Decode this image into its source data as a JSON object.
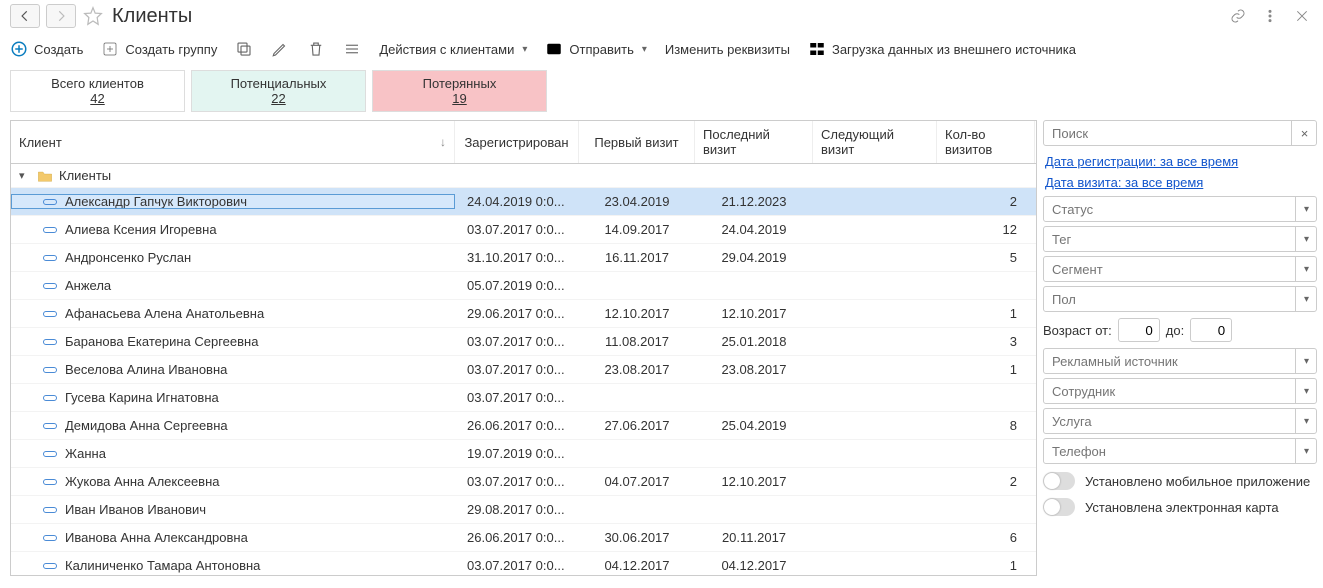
{
  "title": "Клиенты",
  "toolbar": {
    "create": "Создать",
    "create_group": "Создать группу",
    "actions": "Действия с клиентами",
    "send": "Отправить",
    "edit_req": "Изменить реквизиты",
    "load_ext": "Загрузка данных из внешнего источника"
  },
  "stats": {
    "all_label": "Всего клиентов",
    "all_count": "42",
    "potential_label": "Потенциальных",
    "potential_count": "22",
    "lost_label": "Потерянных",
    "lost_count": "19"
  },
  "columns": {
    "client": "Клиент",
    "registered": "Зарегистрирован",
    "first_visit": "Первый визит",
    "last_visit": "Последний визит",
    "next_visit": "Следующий визит",
    "visit_count": "Кол-во визитов"
  },
  "group_label": "Клиенты",
  "rows": [
    {
      "name": "Александр Гапчук Викторович",
      "reg": "24.04.2019 0:0...",
      "first": "23.04.2019",
      "last": "21.12.2023",
      "next": "",
      "visits": "2",
      "selected": true
    },
    {
      "name": "Алиева Ксения Игоревна",
      "reg": "03.07.2017 0:0...",
      "first": "14.09.2017",
      "last": "24.04.2019",
      "next": "",
      "visits": "12"
    },
    {
      "name": "Андронсенко Руслан",
      "reg": "31.10.2017 0:0...",
      "first": "16.11.2017",
      "last": "29.04.2019",
      "next": "",
      "visits": "5"
    },
    {
      "name": "Анжела",
      "reg": "05.07.2019 0:0...",
      "first": "",
      "last": "",
      "next": "",
      "visits": ""
    },
    {
      "name": "Афанасьева Алена Анатольевна",
      "reg": "29.06.2017 0:0...",
      "first": "12.10.2017",
      "last": "12.10.2017",
      "next": "",
      "visits": "1"
    },
    {
      "name": "Баранова Екатерина Сергеевна",
      "reg": "03.07.2017 0:0...",
      "first": "11.08.2017",
      "last": "25.01.2018",
      "next": "",
      "visits": "3"
    },
    {
      "name": "Веселова Алина Ивановна",
      "reg": "03.07.2017 0:0...",
      "first": "23.08.2017",
      "last": "23.08.2017",
      "next": "",
      "visits": "1"
    },
    {
      "name": "Гусева Карина Игнатовна",
      "reg": "03.07.2017 0:0...",
      "first": "",
      "last": "",
      "next": "",
      "visits": ""
    },
    {
      "name": "Демидова Анна Сергеевна",
      "reg": "26.06.2017 0:0...",
      "first": "27.06.2017",
      "last": "25.04.2019",
      "next": "",
      "visits": "8"
    },
    {
      "name": "Жанна",
      "reg": "19.07.2019 0:0...",
      "first": "",
      "last": "",
      "next": "",
      "visits": ""
    },
    {
      "name": "Жукова Анна Алексеевна",
      "reg": "03.07.2017 0:0...",
      "first": "04.07.2017",
      "last": "12.10.2017",
      "next": "",
      "visits": "2"
    },
    {
      "name": "Иван Иванов Иванович",
      "reg": "29.08.2017 0:0...",
      "first": "",
      "last": "",
      "next": "",
      "visits": ""
    },
    {
      "name": "Иванова Анна Александровна",
      "reg": "26.06.2017 0:0...",
      "first": "30.06.2017",
      "last": "20.11.2017",
      "next": "",
      "visits": "6"
    },
    {
      "name": "Калиниченко Тамара Антоновна",
      "reg": "03.07.2017 0:0...",
      "first": "04.12.2017",
      "last": "04.12.2017",
      "next": "",
      "visits": "1"
    }
  ],
  "filters": {
    "search_ph": "Поиск",
    "reg_date_link": "Дата регистрации: за все время",
    "visit_date_link": "Дата визита: за все время",
    "status_ph": "Статус",
    "tag_ph": "Тег",
    "segment_ph": "Сегмент",
    "gender_ph": "Пол",
    "age_from_label": "Возраст от:",
    "age_to_label": "до:",
    "age_from": "0",
    "age_to": "0",
    "adsource_ph": "Рекламный источник",
    "employee_ph": "Сотрудник",
    "service_ph": "Услуга",
    "phone_ph": "Телефон",
    "toggle_mobile": "Установлено мобильное приложение",
    "toggle_card": "Установлена электронная карта"
  }
}
